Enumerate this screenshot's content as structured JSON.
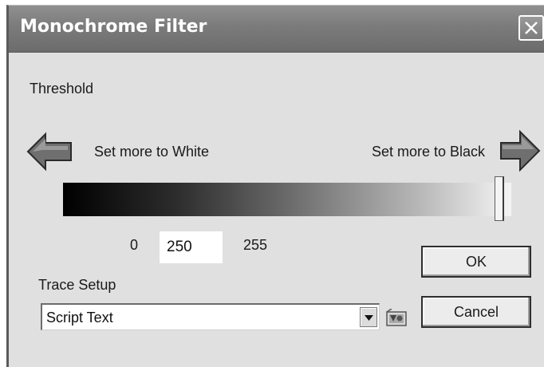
{
  "window": {
    "title": "Monochrome Filter",
    "close_icon": "close-x-icon"
  },
  "threshold": {
    "heading": "Threshold",
    "left_arrow_icon": "left-arrow-icon",
    "right_arrow_icon": "right-arrow-icon",
    "left_hint": "Set more to White",
    "right_hint": "Set more to Black",
    "min_label": "0",
    "max_label": "255",
    "value": "250",
    "slider_value": 250,
    "slider_min": 0,
    "slider_max": 255
  },
  "trace_setup": {
    "label": "Trace Setup",
    "selected": "Script Text",
    "settings_icon": "trace-settings-icon"
  },
  "buttons": {
    "ok": "OK",
    "cancel": "Cancel"
  }
}
